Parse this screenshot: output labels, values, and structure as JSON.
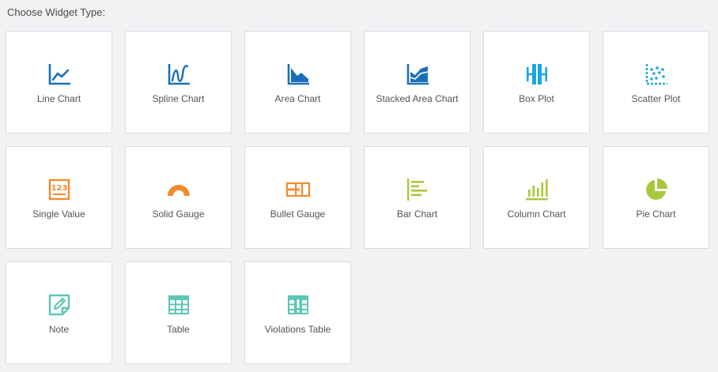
{
  "header": {
    "title": "Choose Widget Type:"
  },
  "colors": {
    "blue": "#1b6fb8",
    "cyan": "#1aa6e6",
    "orange": "#f28a2e",
    "lime": "#a6c83a",
    "teal": "#5bc7b4"
  },
  "widgets": [
    {
      "label": "Line Chart",
      "icon": "line-chart-icon"
    },
    {
      "label": "Spline Chart",
      "icon": "spline-chart-icon"
    },
    {
      "label": "Area Chart",
      "icon": "area-chart-icon"
    },
    {
      "label": "Stacked Area Chart",
      "icon": "stacked-area-chart-icon"
    },
    {
      "label": "Box Plot",
      "icon": "box-plot-icon"
    },
    {
      "label": "Scatter Plot",
      "icon": "scatter-plot-icon"
    },
    {
      "label": "Single Value",
      "icon": "single-value-icon"
    },
    {
      "label": "Solid Gauge",
      "icon": "solid-gauge-icon"
    },
    {
      "label": "Bullet Gauge",
      "icon": "bullet-gauge-icon"
    },
    {
      "label": "Bar Chart",
      "icon": "bar-chart-icon"
    },
    {
      "label": "Column Chart",
      "icon": "column-chart-icon"
    },
    {
      "label": "Pie Chart",
      "icon": "pie-chart-icon"
    },
    {
      "label": "Note",
      "icon": "note-icon"
    },
    {
      "label": "Table",
      "icon": "table-icon"
    },
    {
      "label": "Violations Table",
      "icon": "violations-table-icon"
    }
  ]
}
